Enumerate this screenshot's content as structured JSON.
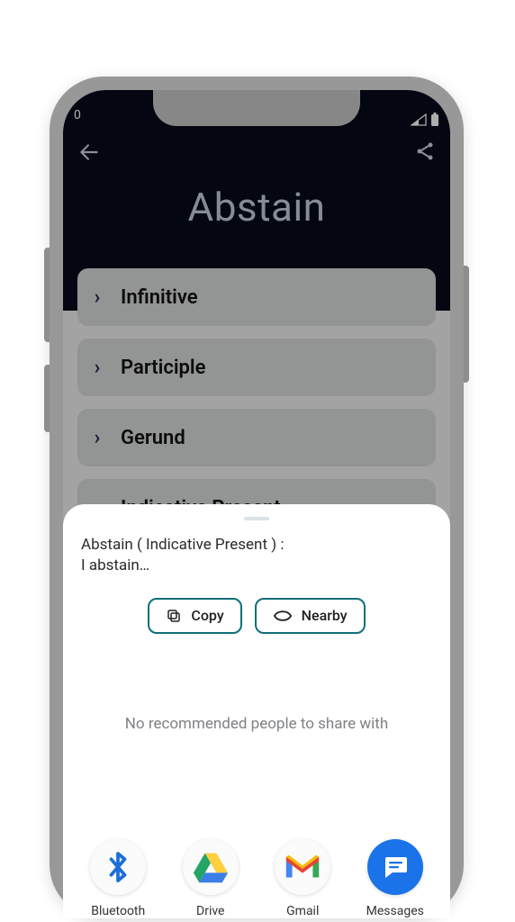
{
  "status": {
    "time_fragment": "0"
  },
  "header": {
    "title": "Abstain"
  },
  "tenses": [
    {
      "label": "Infinitive",
      "expanded": false
    },
    {
      "label": "Participle",
      "expanded": false
    },
    {
      "label": "Gerund",
      "expanded": false
    },
    {
      "label": "Indicative Present",
      "expanded": true
    }
  ],
  "share": {
    "title_line": "Abstain ( Indicative Present )  :",
    "body_line": "I abstain…",
    "copy_label": "Copy",
    "nearby_label": "Nearby",
    "no_recommended": "No recommended people to share with",
    "targets": [
      {
        "label": "Bluetooth",
        "icon": "bluetooth"
      },
      {
        "label": "Drive",
        "icon": "drive"
      },
      {
        "label": "Gmail",
        "icon": "gmail"
      },
      {
        "label": "Messages",
        "icon": "messages"
      }
    ]
  }
}
